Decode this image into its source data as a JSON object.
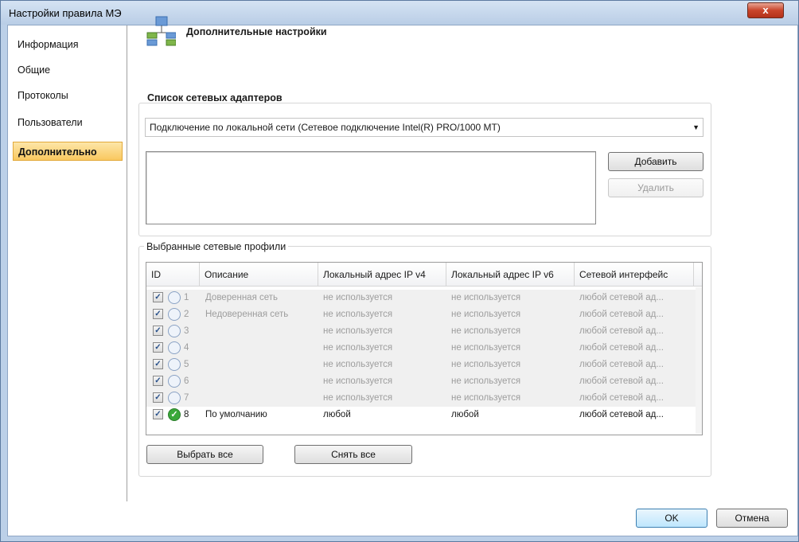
{
  "window": {
    "title": "Настройки правила МЭ",
    "close_label": "x"
  },
  "nav": {
    "items": [
      {
        "label": "Информация"
      },
      {
        "label": "Общие"
      },
      {
        "label": "Протоколы"
      },
      {
        "label": "Пользователи"
      },
      {
        "label": "Дополнительно"
      }
    ],
    "active": "Дополнительно"
  },
  "header": {
    "title": "Дополнительные настройки",
    "icon": "network-icon"
  },
  "adapters": {
    "label": "Список сетевых адаптеров",
    "selected": "Подключение по локальной сети (Сетевое подключение Intel(R) PRO/1000 MT)",
    "add_label": "Добавить",
    "remove_label": "Удалить"
  },
  "profiles": {
    "label": "Выбранные сетевые профили",
    "columns": [
      "ID",
      "Описание",
      "Локальный адрес IP v4",
      "Локальный адрес IP v6",
      "Сетевой интерфейс"
    ],
    "rows": [
      {
        "id": "1",
        "desc": "Доверенная сеть",
        "ipv4": "не используется",
        "ipv6": "не используется",
        "iface": "любой сетевой ад...",
        "checked": true,
        "active": false
      },
      {
        "id": "2",
        "desc": "Недоверенная сеть",
        "ipv4": "не используется",
        "ipv6": "не используется",
        "iface": "любой сетевой ад...",
        "checked": true,
        "active": false
      },
      {
        "id": "3",
        "desc": "",
        "ipv4": "не используется",
        "ipv6": "не используется",
        "iface": "любой сетевой ад...",
        "checked": true,
        "active": false
      },
      {
        "id": "4",
        "desc": "",
        "ipv4": "не используется",
        "ipv6": "не используется",
        "iface": "любой сетевой ад...",
        "checked": true,
        "active": false
      },
      {
        "id": "5",
        "desc": "",
        "ipv4": "не используется",
        "ipv6": "не используется",
        "iface": "любой сетевой ад...",
        "checked": true,
        "active": false
      },
      {
        "id": "6",
        "desc": "",
        "ipv4": "не используется",
        "ipv6": "не используется",
        "iface": "любой сетевой ад...",
        "checked": true,
        "active": false
      },
      {
        "id": "7",
        "desc": "",
        "ipv4": "не используется",
        "ipv6": "не используется",
        "iface": "любой сетевой ад...",
        "checked": true,
        "active": false
      },
      {
        "id": "8",
        "desc": "По умолчанию",
        "ipv4": "любой",
        "ipv6": "любой",
        "iface": "любой сетевой ад...",
        "checked": true,
        "active": true
      }
    ],
    "select_all_label": "Выбрать все",
    "deselect_all_label": "Снять все"
  },
  "footer": {
    "ok_label": "OK",
    "cancel_label": "Отмена"
  },
  "colors": {
    "nav_active": "#f9c85f",
    "title_bar": "#c7d8ee",
    "close_button": "#c9452b"
  }
}
